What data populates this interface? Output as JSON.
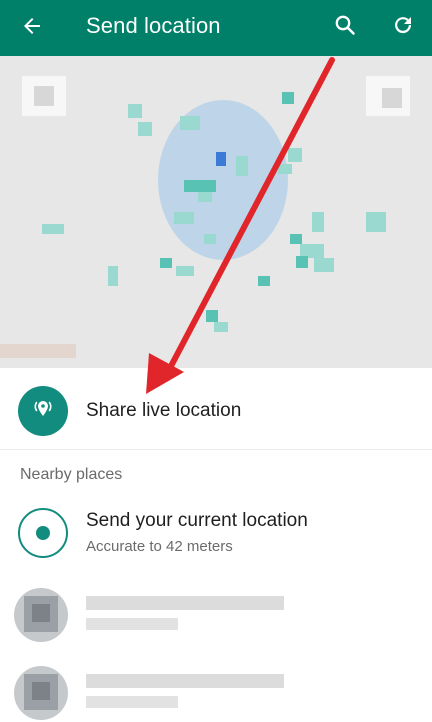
{
  "appbar": {
    "title": "Send location",
    "back_icon": "arrow-left-icon",
    "search_icon": "search-icon",
    "refresh_icon": "refresh-icon",
    "color": "#008069"
  },
  "map": {
    "accent": "#58c3b5"
  },
  "live": {
    "label": "Share live location",
    "icon": "live-location-icon",
    "color": "#128c7e"
  },
  "nearby": {
    "section_label": "Nearby places",
    "current": {
      "title": "Send your current location",
      "subtitle": "Accurate to 42 meters",
      "icon": "current-location-icon"
    },
    "places": [
      {
        "name": "",
        "address": ""
      },
      {
        "name": "",
        "address": ""
      }
    ]
  },
  "annotation": {
    "color": "#e0262b"
  }
}
